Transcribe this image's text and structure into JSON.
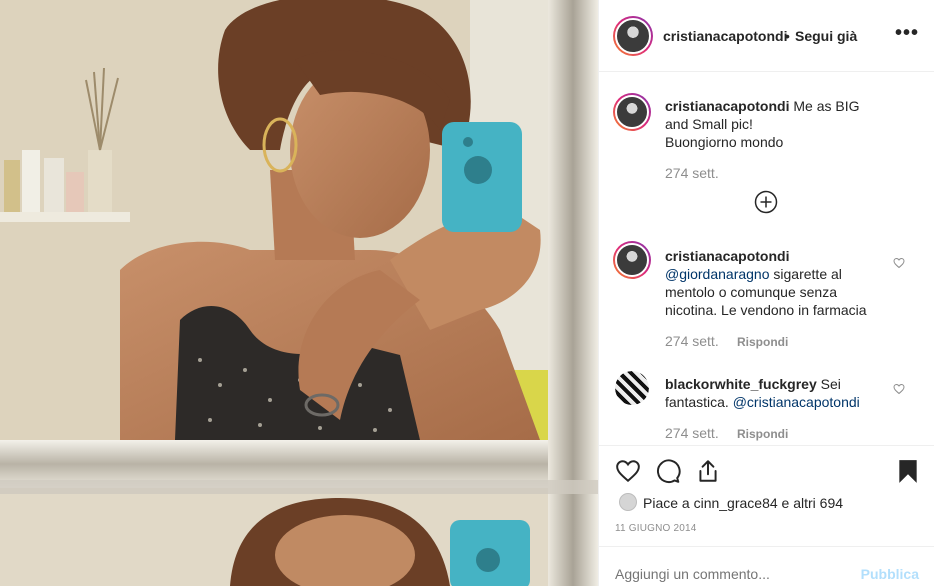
{
  "post": {
    "username": "cristianacapotondi",
    "separator": "•",
    "follow_state": "Segui già",
    "more_label": "•••"
  },
  "caption": {
    "username": "cristianacapotondi",
    "line1": "Me as BIG and Small pic!",
    "line2": "Buongiorno mondo",
    "time": "274 sett."
  },
  "comments": [
    {
      "username": "cristianacapotondi",
      "mention": "@giordanaragno",
      "text": "sigarette al mentolo o comunque senza nicotina. Le vendono in farmacia",
      "time": "274 sett.",
      "reply": "Rispondi"
    },
    {
      "username": "blackorwhite_fuckgrey",
      "text": "Sei fantastica.",
      "mention": "@cristianacapotondi",
      "time": "274 sett.",
      "reply": "Rispondi"
    }
  ],
  "likes": {
    "text": "Piace a cinn_grace84 e altri 694"
  },
  "date": "11 GIUGNO 2014",
  "composer": {
    "placeholder": "Aggiungi un commento...",
    "publish_label": "Pubblica"
  },
  "icons": [
    "more-icon",
    "heart-icon",
    "comment-icon",
    "share-icon",
    "bookmark-icon",
    "plus-circle-icon"
  ],
  "colors": {
    "link": "#003569",
    "muted": "#8e8e8e",
    "publish": "#b2dffc",
    "border": "#efefef"
  }
}
